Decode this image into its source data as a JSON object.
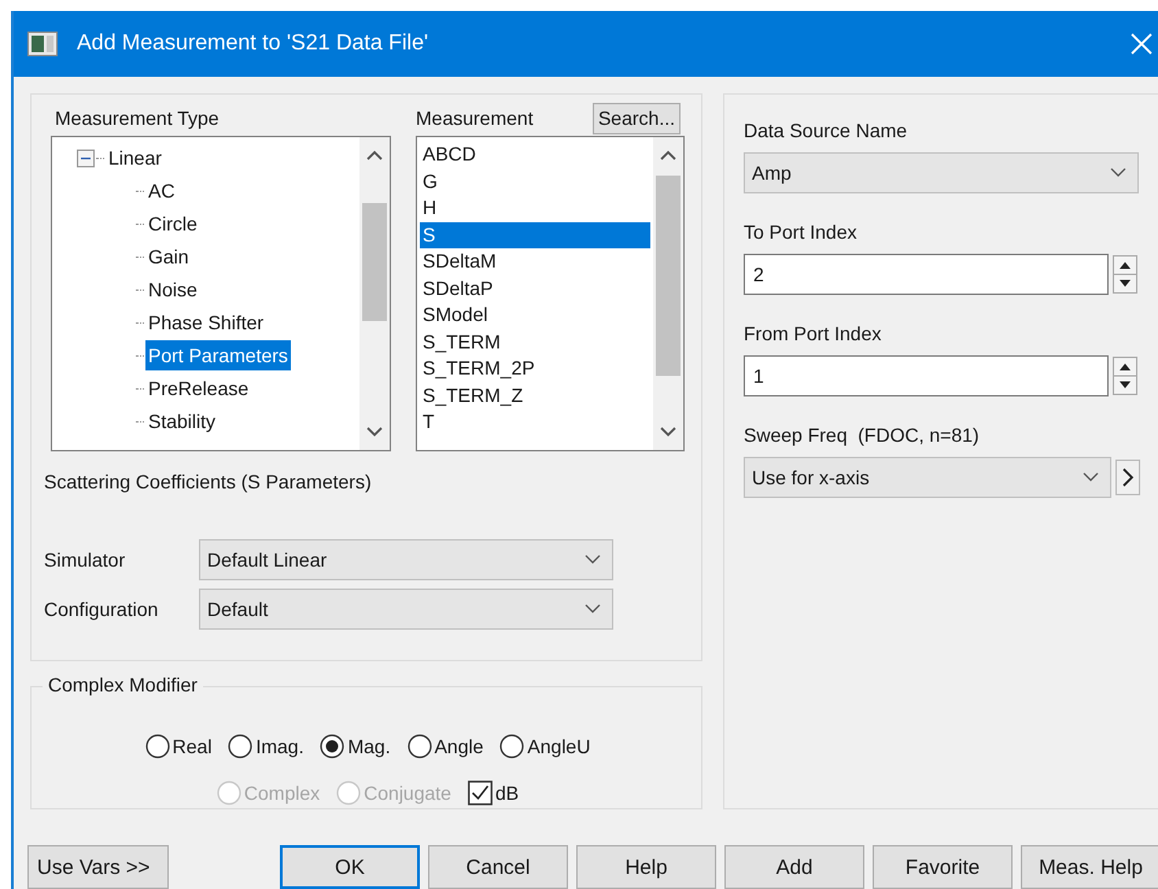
{
  "window": {
    "title": "Add Measurement to 'S21 Data File'"
  },
  "measurement_type": {
    "label": "Measurement Type",
    "tree": [
      {
        "label": "Linear",
        "expanded": true,
        "selected": false,
        "children": [
          {
            "label": "AC",
            "selected": false
          },
          {
            "label": "Circle",
            "selected": false
          },
          {
            "label": "Gain",
            "selected": false
          },
          {
            "label": "Noise",
            "selected": false
          },
          {
            "label": "Phase Shifter",
            "selected": false
          },
          {
            "label": "Port Parameters",
            "selected": true
          },
          {
            "label": "PreRelease",
            "selected": false
          },
          {
            "label": "Stability",
            "selected": false
          }
        ]
      }
    ]
  },
  "measurement": {
    "label": "Measurement",
    "search_button": "Search...",
    "items": [
      {
        "label": "ABCD",
        "selected": false
      },
      {
        "label": "G",
        "selected": false
      },
      {
        "label": "H",
        "selected": false
      },
      {
        "label": "S",
        "selected": true
      },
      {
        "label": "SDeltaM",
        "selected": false
      },
      {
        "label": "SDeltaP",
        "selected": false
      },
      {
        "label": "SModel",
        "selected": false
      },
      {
        "label": "S_TERM",
        "selected": false
      },
      {
        "label": "S_TERM_2P",
        "selected": false
      },
      {
        "label": "S_TERM_Z",
        "selected": false
      },
      {
        "label": "T",
        "selected": false
      }
    ]
  },
  "description": "Scattering Coefficients (S Parameters)",
  "settings": [
    {
      "label": "Simulator",
      "value": "Default Linear"
    },
    {
      "label": "Configuration",
      "value": "Default"
    }
  ],
  "complex_modifier": {
    "title": "Complex Modifier",
    "options": [
      {
        "kind": "radio",
        "label": "Real",
        "selected": false,
        "disabled": false
      },
      {
        "kind": "radio",
        "label": "Imag.",
        "selected": false,
        "disabled": false
      },
      {
        "kind": "radio",
        "label": "Mag.",
        "selected": true,
        "disabled": false
      },
      {
        "kind": "radio",
        "label": "Angle",
        "selected": false,
        "disabled": false
      },
      {
        "kind": "radio",
        "label": "AngleU",
        "selected": false,
        "disabled": false
      },
      {
        "kind": "radio",
        "label": "Complex",
        "selected": false,
        "disabled": true
      },
      {
        "kind": "radio",
        "label": "Conjugate",
        "selected": false,
        "disabled": true
      },
      {
        "kind": "checkbox",
        "label": "dB",
        "checked": true
      }
    ]
  },
  "right_panel": [
    {
      "kind": "dropdown",
      "label": "Data Source Name",
      "value": "Amp"
    },
    {
      "kind": "spinner",
      "label": "To Port Index",
      "value": "2"
    },
    {
      "kind": "spinner",
      "label": "From Port Index",
      "value": "1"
    },
    {
      "kind": "dropdown_more",
      "label": "Sweep Freq  (FDOC, n=81)",
      "value": "Use for x-axis"
    }
  ],
  "buttons": [
    {
      "label": "Use Vars >>",
      "default": false
    },
    {
      "label": "OK",
      "default": true
    },
    {
      "label": "Cancel",
      "default": false
    },
    {
      "label": "Help",
      "default": false
    },
    {
      "label": "Add",
      "default": false
    },
    {
      "label": "Favorite",
      "default": false
    },
    {
      "label": "Meas. Help",
      "default": false
    }
  ]
}
